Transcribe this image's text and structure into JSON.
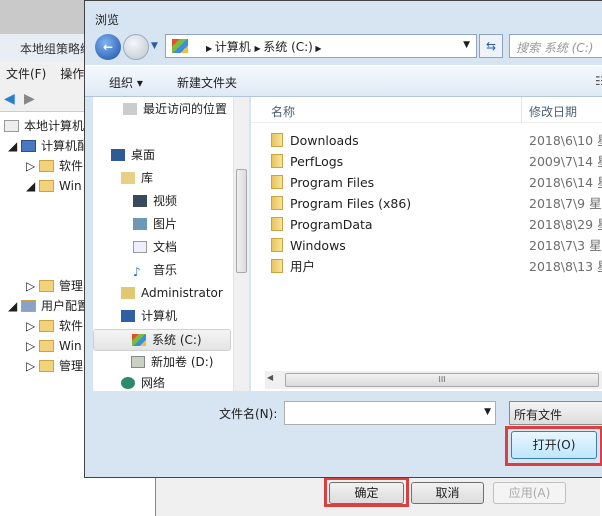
{
  "background_window": {
    "title": "本地组策略编",
    "menu": [
      "文件(F)",
      "操作"
    ],
    "tree": [
      {
        "label": "本地计算机",
        "level": 0
      },
      {
        "label": "计算机配",
        "level": 1
      },
      {
        "label": "软件",
        "level": 2
      },
      {
        "label": "Win",
        "level": 2
      },
      {
        "label": "管理",
        "level": 2
      },
      {
        "label": "用户配置",
        "level": 1
      },
      {
        "label": "软件",
        "level": 2
      },
      {
        "label": "Win",
        "level": 2
      },
      {
        "label": "管理",
        "level": 2
      }
    ],
    "buttons": {
      "ok": "确定",
      "cancel": "取消",
      "apply": "应用(A)"
    }
  },
  "dialog": {
    "title": "浏览",
    "breadcrumb": [
      "计算机",
      "系统 (C:)"
    ],
    "search_placeholder": "搜索 系统 (C:)",
    "toolbar": {
      "organize": "组织 ▾",
      "new_folder": "新建文件夹"
    },
    "nav_pane": [
      {
        "label": "最近访问的位置",
        "icon": "recent-icon"
      },
      {
        "label": "桌面",
        "icon": "desktop-icon"
      },
      {
        "label": "库",
        "icon": "library-icon"
      },
      {
        "label": "视频",
        "icon": "video-icon"
      },
      {
        "label": "图片",
        "icon": "picture-icon"
      },
      {
        "label": "文档",
        "icon": "document-icon"
      },
      {
        "label": "音乐",
        "icon": "music-icon"
      },
      {
        "label": "Administrator",
        "icon": "user-folder-icon"
      },
      {
        "label": "计算机",
        "icon": "computer-icon"
      },
      {
        "label": "系统 (C:)",
        "icon": "drive-icon",
        "selected": true
      },
      {
        "label": "新加卷 (D:)",
        "icon": "drive-icon"
      },
      {
        "label": "网络",
        "icon": "network-icon"
      }
    ],
    "columns": {
      "name": "名称",
      "date": "修改日期"
    },
    "files": [
      {
        "name": "Downloads",
        "date": "2018\\6\\10 星"
      },
      {
        "name": "PerfLogs",
        "date": "2009\\7\\14 星"
      },
      {
        "name": "Program Files",
        "date": "2018\\6\\14 星"
      },
      {
        "name": "Program Files (x86)",
        "date": "2018\\7\\9 星期"
      },
      {
        "name": "ProgramData",
        "date": "2018\\8\\29 星"
      },
      {
        "name": "Windows",
        "date": "2018\\7\\3 星期"
      },
      {
        "name": "用户",
        "date": "2018\\8\\13 星"
      }
    ],
    "filename_label": "文件名(N):",
    "filename_value": "",
    "filetype": "所有文件",
    "open_button": "打开(O)"
  },
  "colors": {
    "highlight": "#d9403f",
    "titlebar": "#d7e4f2"
  }
}
